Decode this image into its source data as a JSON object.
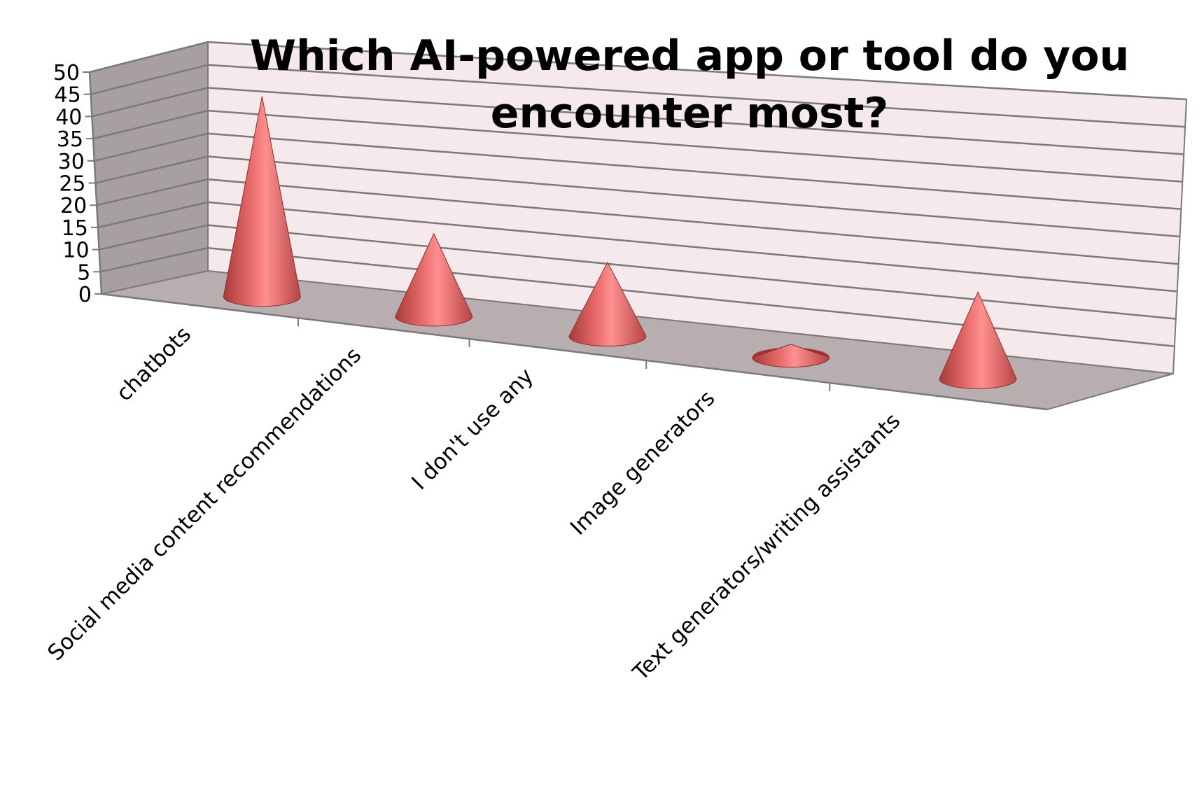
{
  "chart_data": {
    "type": "bar",
    "title": "Which AI-powered app or tool do you encounter most?",
    "title_lines": [
      "Which AI-powered app or tool do you",
      "encounter most?"
    ],
    "categories": [
      "chatbots",
      "Social media content recommendations",
      "I don't use any",
      "Image generators",
      "Text generators/writing assistants"
    ],
    "values": [
      46,
      19,
      17,
      3,
      20
    ],
    "ylim": [
      0,
      50
    ],
    "yticks": [
      0,
      5,
      10,
      15,
      20,
      25,
      30,
      35,
      40,
      45,
      50
    ],
    "xlabel": "",
    "ylabel": "",
    "legend": "none",
    "grid": true,
    "style": "3d-cone",
    "colors": {
      "cone_light": "#ff8a8a",
      "cone_mid": "#e06060",
      "cone_dark": "#9e3434",
      "back_wall": "#f5e9eb",
      "side_wall": "#a89fa1",
      "floor": "#b8aeb0",
      "gridline": "#7a7a7a"
    }
  }
}
